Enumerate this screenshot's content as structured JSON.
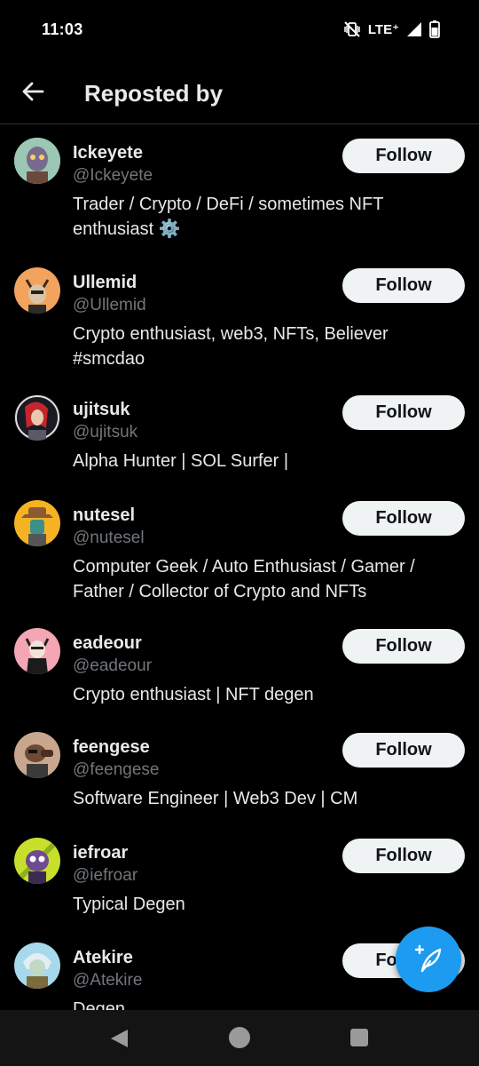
{
  "status_bar": {
    "time": "11:03",
    "network": "LTE⁺",
    "icons": [
      "mute-vibrate-icon",
      "signal-icon",
      "battery-icon"
    ]
  },
  "header": {
    "title": "Reposted by",
    "back_icon": "arrow-left-icon"
  },
  "colors": {
    "background": "#000000",
    "primary_text": "#e7e9ea",
    "secondary_text": "#71767b",
    "follow_button_bg": "#eff3f4",
    "accent": "#1d9bf0"
  },
  "users": [
    {
      "name": "Ickeyete",
      "handle": "@Ickeyete",
      "bio": "Trader / Crypto / DeFi / sometimes NFT enthusiast ⚙️",
      "button": "Follow"
    },
    {
      "name": "Ullemid",
      "handle": "@Ullemid",
      "bio": "Crypto enthusiast, web3, NFTs, Believer #smcdao",
      "button": "Follow"
    },
    {
      "name": "ujitsuk",
      "handle": "@ujitsuk",
      "bio": "Alpha Hunter | SOL Surfer |",
      "button": "Follow"
    },
    {
      "name": "nutesel",
      "handle": "@nutesel",
      "bio": "Computer Geek / Auto Enthusiast / Gamer / Father / Collector of Crypto and NFTs",
      "button": "Follow"
    },
    {
      "name": "eadeour",
      "handle": "@eadeour",
      "bio": "Crypto enthusiast | NFT degen",
      "button": "Follow"
    },
    {
      "name": "feengese",
      "handle": "@feengese",
      "bio": "Software Engineer | Web3 Dev | CM",
      "button": "Follow"
    },
    {
      "name": "iefroar",
      "handle": "@iefroar",
      "bio": "Typical Degen",
      "button": "Follow"
    },
    {
      "name": "Atekire",
      "handle": "@Atekire",
      "bio": "Degen",
      "button": "Follow"
    }
  ],
  "fab": {
    "icon": "compose-feather-plus-icon"
  },
  "nav_bar": {
    "icons": [
      "nav-back-icon",
      "nav-home-icon",
      "nav-recents-icon"
    ]
  }
}
